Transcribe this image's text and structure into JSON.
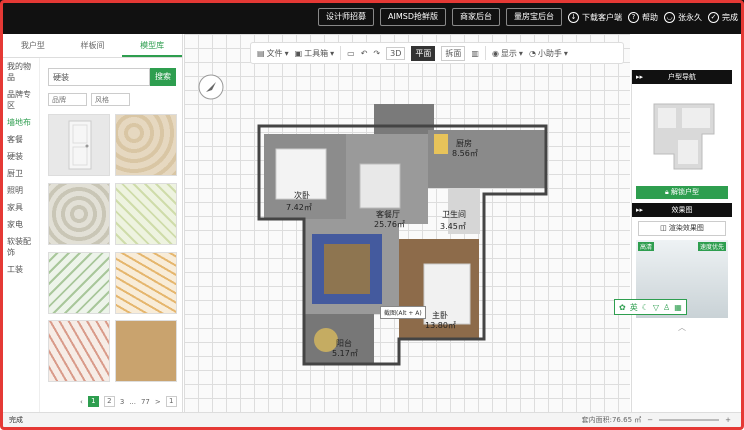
{
  "topbar": {
    "btn1": "设计师招募",
    "btn2": "AIMSD抢鲜版",
    "btn3": "商家后台",
    "btn4": "量房宝后台",
    "download": "下载客户端",
    "help": "帮助",
    "user": "张永久",
    "done": "完成"
  },
  "left": {
    "tabs": [
      "我户型",
      "样板间",
      "模型库"
    ],
    "categories": [
      "我的物品",
      "品牌专区",
      "墙地布",
      "客餐",
      "硬装",
      "厨卫",
      "照明",
      "家具",
      "家电",
      "软装配饰",
      "工装"
    ],
    "search_value": "硬装",
    "search_button": "搜索",
    "filter_brand": "品牌",
    "filter_style": "风格",
    "pages": [
      "1",
      "2",
      "3",
      "...",
      "77",
      ">",
      "1"
    ]
  },
  "toolbar": {
    "file": "文件",
    "tools": "工具箱",
    "view3d": "3D",
    "plan": "平面",
    "unfold": "拆面",
    "display": "显示",
    "helper": "小助手"
  },
  "rooms": [
    {
      "name": "次卧",
      "area": "7.42㎡"
    },
    {
      "name": "厨房",
      "area": "8.56㎡"
    },
    {
      "name": "客餐厅",
      "area": "25.76㎡"
    },
    {
      "name": "卫生间",
      "area": "3.45㎡"
    },
    {
      "name": "主卧",
      "area": "13.80㎡"
    },
    {
      "name": "阳台",
      "area": "5.17㎡"
    }
  ],
  "popup": "截图(Alt + A)",
  "right": {
    "house_nav": "户型导航",
    "unlock": "解锁户型",
    "effects": "效果图",
    "render": "渲染效果图",
    "tag_hd": "高清",
    "tag_speed": "速度优先"
  },
  "floatbar": "英",
  "status": {
    "left": "完成",
    "area": "套内面积:76.65 ㎡"
  }
}
